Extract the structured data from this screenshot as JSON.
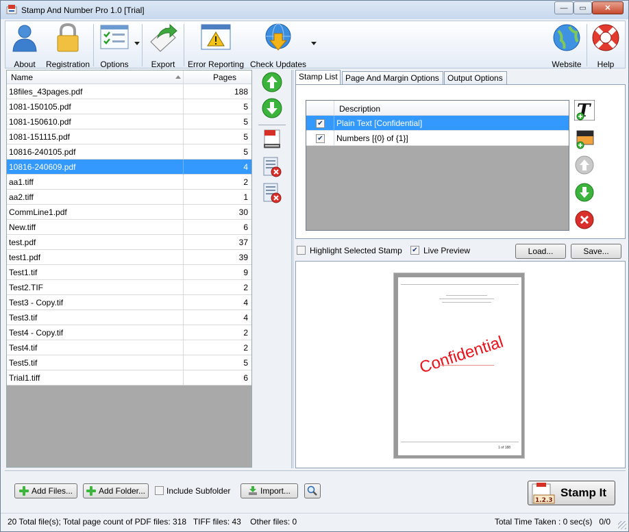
{
  "window": {
    "title": "Stamp And Number Pro 1.0 [Trial]",
    "minimize_glyph": "—",
    "maximize_glyph": "▭",
    "close_glyph": "✕"
  },
  "toolbar": {
    "about": "About",
    "registration": "Registration",
    "options": "Options",
    "export": "Export",
    "error_reporting": "Error Reporting",
    "check_updates": "Check Updates",
    "website": "Website",
    "help": "Help"
  },
  "file_list": {
    "col_name": "Name",
    "col_pages": "Pages",
    "selected_index": 5,
    "rows": [
      {
        "name": "18files_43pages.pdf",
        "pages": "188"
      },
      {
        "name": "1081-150105.pdf",
        "pages": "5"
      },
      {
        "name": "1081-150610.pdf",
        "pages": "5"
      },
      {
        "name": "1081-151115.pdf",
        "pages": "5"
      },
      {
        "name": "10816-240105.pdf",
        "pages": "5"
      },
      {
        "name": "10816-240609.pdf",
        "pages": "4"
      },
      {
        "name": "aa1.tiff",
        "pages": "2"
      },
      {
        "name": "aa2.tiff",
        "pages": "1"
      },
      {
        "name": "CommLine1.pdf",
        "pages": "30"
      },
      {
        "name": "New.tiff",
        "pages": "6"
      },
      {
        "name": "test.pdf",
        "pages": "37"
      },
      {
        "name": "test1.pdf",
        "pages": "39"
      },
      {
        "name": "Test1.tif",
        "pages": "9"
      },
      {
        "name": "Test2.TIF",
        "pages": "2"
      },
      {
        "name": "Test3 - Copy.tif",
        "pages": "4"
      },
      {
        "name": "Test3.tif",
        "pages": "4"
      },
      {
        "name": "Test4 - Copy.tif",
        "pages": "2"
      },
      {
        "name": "Test4.tif",
        "pages": "2"
      },
      {
        "name": "Test5.tif",
        "pages": "5"
      },
      {
        "name": "Trial1.tiff",
        "pages": "6"
      }
    ]
  },
  "tabs": {
    "stamp_list": "Stamp List",
    "page_margin": "Page And Margin Options",
    "output": "Output Options"
  },
  "stamp_list": {
    "col_description": "Description",
    "items": [
      {
        "text": "Plain Text [Confidential]",
        "checked": true,
        "selected": true
      },
      {
        "text": "Numbers [{0} of {1}]",
        "checked": true,
        "selected": false
      }
    ]
  },
  "preview_controls": {
    "highlight_label": "Highlight Selected Stamp",
    "highlight_checked": false,
    "live_preview_label": "Live Preview",
    "live_preview_checked": true,
    "load_button": "Load...",
    "save_button": "Save..."
  },
  "preview": {
    "stamp_text": "Confidential",
    "stamp_color": "#e8121c",
    "page_number_text": "1 of 188"
  },
  "bottom": {
    "add_files": "Add Files...",
    "add_folder": "Add Folder...",
    "include_subfolder": "Include Subfolder",
    "include_subfolder_checked": false,
    "import": "Import...",
    "stamp_it": "Stamp It",
    "stamp_badge": "1.2.3"
  },
  "status": {
    "left": "20 Total file(s); Total page count of PDF files: 318   TIFF files: 43    Other files: 0",
    "right": "Total Time Taken : 0 sec(s)   0/0"
  },
  "colors": {
    "selection": "#3399ff",
    "accent_green": "#3bb63b",
    "delete_red": "#d9302b"
  }
}
